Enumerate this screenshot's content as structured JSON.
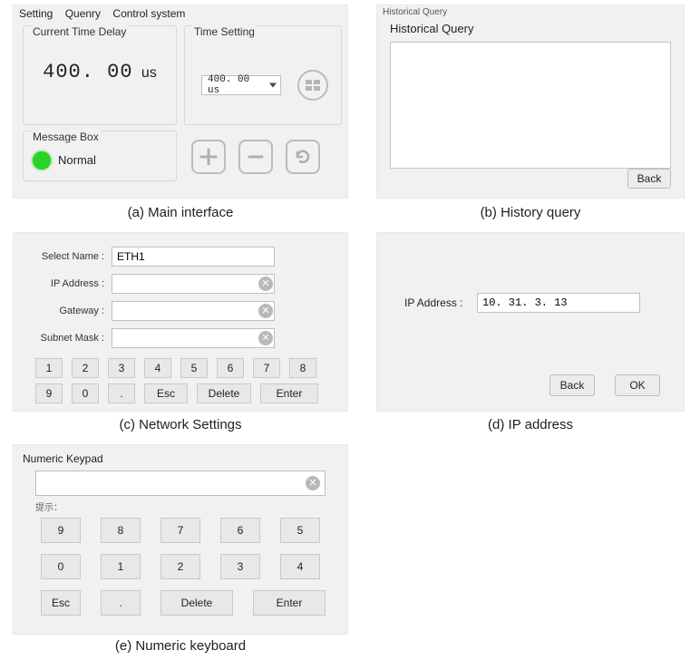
{
  "captions": {
    "a": "(a) Main interface",
    "b": "(b) History query",
    "c": "(c) Network Settings",
    "d": "(d)   IP address",
    "e": "(e) Numeric keyboard"
  },
  "main": {
    "menu": {
      "setting": "Setting",
      "query": "Quenry",
      "control": "Control system"
    },
    "delay_group_title": "Current Time Delay",
    "delay_value": "400. 00",
    "delay_unit": "us",
    "time_group_title": "Time Setting",
    "time_select_value": "400. 00 us",
    "msgbox_title": "Message Box",
    "status_text": "Normal"
  },
  "history": {
    "window_title": "Historical Query",
    "panel_title": "Historical Query",
    "back_label": "Back"
  },
  "network": {
    "labels": {
      "select_name": "Select Name :",
      "ip": "IP Address :",
      "gateway": "Gateway :",
      "subnet": "Subnet Mask :"
    },
    "values": {
      "select_name": "ETH1",
      "ip": "",
      "gateway": "",
      "subnet": ""
    },
    "keys": [
      "1",
      "2",
      "3",
      "4",
      "5",
      "6",
      "7",
      "8",
      "Esc",
      "0",
      ".",
      "",
      "Delete",
      "",
      "Enter",
      ""
    ],
    "row1": [
      "1",
      "2",
      "3",
      "4",
      "5",
      "6",
      "7",
      "8"
    ],
    "row2a": [
      "9",
      "0",
      "."
    ],
    "row2b": {
      "esc": "Esc",
      "delete": "Delete",
      "enter": "Enter"
    }
  },
  "ipaddr": {
    "label": "IP Address :",
    "value": "10. 31. 3. 13",
    "back": "Back",
    "ok": "OK"
  },
  "keypad": {
    "title": "Numeric Keypad",
    "hint": "提示：",
    "value": "",
    "row1": [
      "9",
      "8",
      "7",
      "6",
      "5"
    ],
    "row2": [
      "0",
      "1",
      "2",
      "3",
      "4"
    ],
    "row3": {
      "esc": "Esc",
      "dot": ".",
      "delete": "Delete",
      "enter": "Enter"
    }
  }
}
